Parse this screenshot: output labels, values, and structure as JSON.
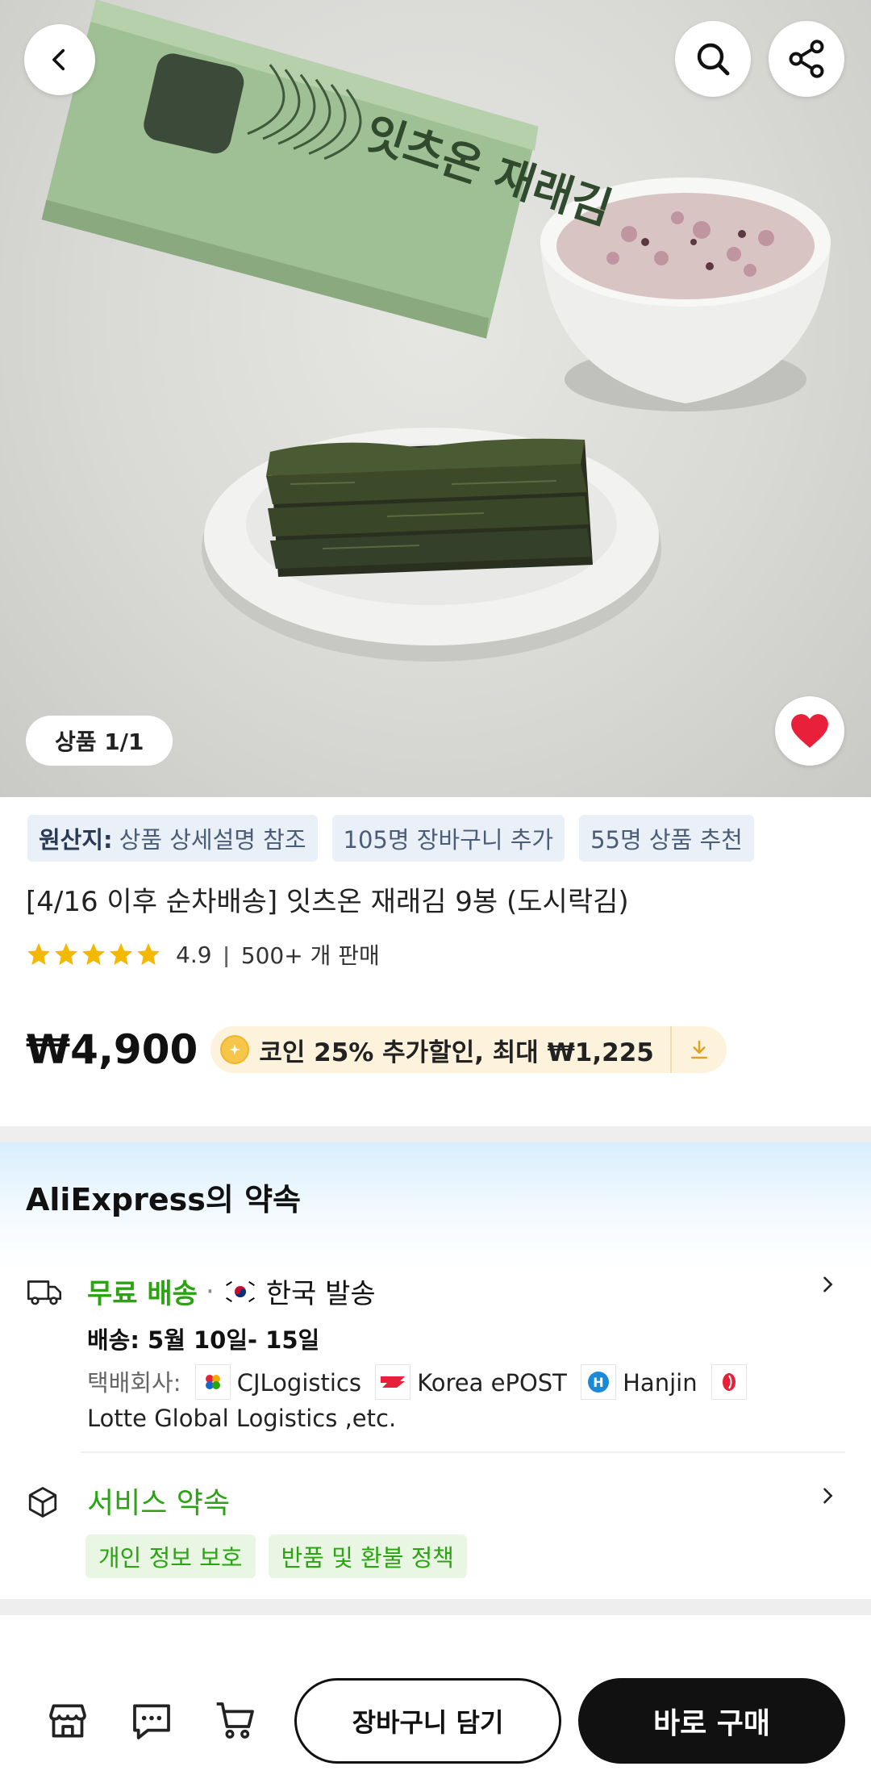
{
  "hero": {
    "image_counter": "상품 1/1",
    "package_text": "잇츠온 재래김"
  },
  "info": {
    "tags": [
      {
        "bold": "원산지:",
        "text": "상품 상세설명 참조"
      },
      {
        "bold": "",
        "text": "105명 장바구니 추가"
      },
      {
        "bold": "",
        "text": "55명 상품 추천"
      }
    ],
    "title": "[4/16 이후 순차배송] 잇츠온 재래김 9봉 (도시락김)",
    "rating": "4.9",
    "rating_stars": 5,
    "sold": "500+ 개 판매",
    "price": "₩4,900",
    "coupon": "코인 25% 추가할인, 최대 ₩1,225"
  },
  "promise": {
    "title": "AliExpress의 약속",
    "free_shipping": "무료 배송",
    "ship_from": "한국 발송",
    "delivery": "배송: 5월 10일- 15일",
    "carrier_label": "택배회사:",
    "carriers": [
      "CJLogistics",
      "Korea ePOST",
      "Hanjin",
      "Lotte Global Logistics ,etc."
    ],
    "service_title": "서비스 약속",
    "service_tags": [
      "개인 정보 보호",
      "반품 및 환불 정책"
    ]
  },
  "bottom": {
    "add_cart": "장바구니 담기",
    "buy_now": "바로 구매"
  },
  "colors": {
    "accent_green": "#2aa511",
    "heart_red": "#e8203a",
    "star": "#f5b800"
  }
}
